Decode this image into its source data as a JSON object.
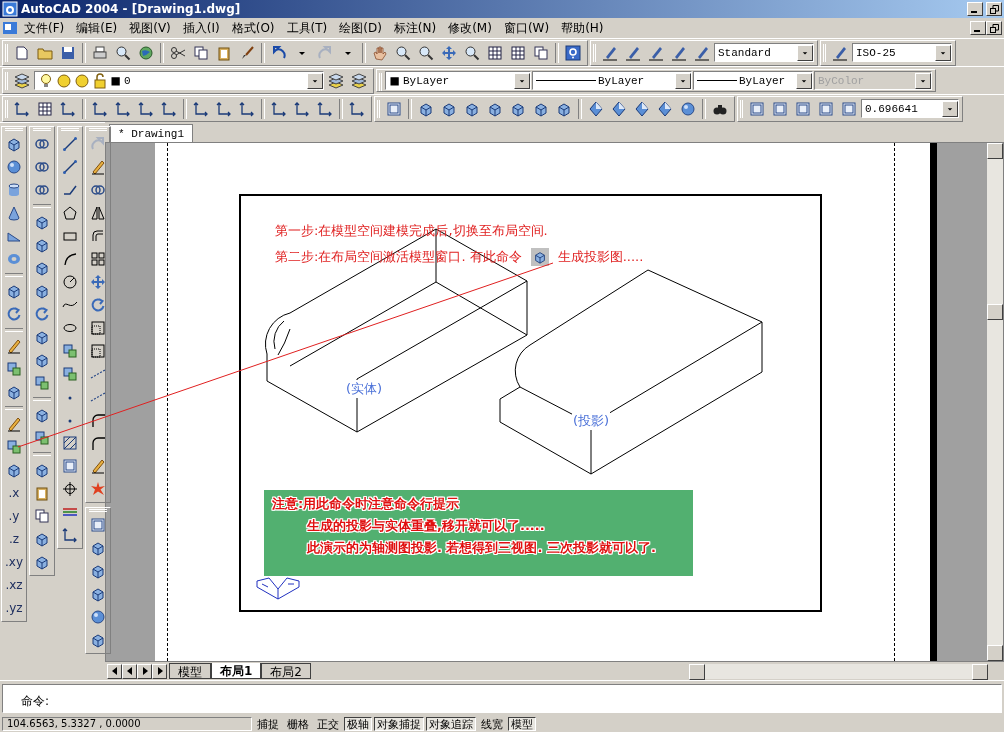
{
  "window": {
    "title": "AutoCAD 2004 - [Drawing1.dwg]"
  },
  "menu": [
    "文件(F)",
    "编辑(E)",
    "视图(V)",
    "插入(I)",
    "格式(O)",
    "工具(T)",
    "绘图(D)",
    "标注(N)",
    "修改(M)",
    "窗口(W)",
    "帮助(H)"
  ],
  "text_style": {
    "value": "Standard"
  },
  "dim_style": {
    "value": "ISO-25"
  },
  "layer": {
    "value": "0"
  },
  "color": {
    "value": "ByLayer"
  },
  "linetype": {
    "value": "ByLayer"
  },
  "lineweight": {
    "value": "ByLayer"
  },
  "plot_style": {
    "value": "ByColor",
    "disabled": true
  },
  "view_scale": {
    "value": "0.696641"
  },
  "coordinate_toolbar": [
    ".x",
    ".y",
    ".z",
    ".xy",
    ".xz",
    ".yz"
  ],
  "document_tab": {
    "title": "* Drawing1"
  },
  "drawing": {
    "steps": [
      "第一步:在模型空间建模完成后,切换至布局空间.",
      "第二步:在布局空间激活模型窗口. 有此命令"
    ],
    "step_suffix": "生成投影图.....",
    "labels": [
      {
        "text": "(实体)"
      },
      {
        "text": "(投影)"
      }
    ],
    "note": {
      "title": "注意:用此命令时注意命令行提示",
      "lines": [
        "生成的投影与实体重叠,移开就可以了.....",
        "此演示的为轴测图投影. 若想得到三视图. 三次投影就可以了."
      ]
    }
  },
  "layout_tabs": [
    {
      "label": "模型",
      "selected": false
    },
    {
      "label": "布局1",
      "selected": true
    },
    {
      "label": "布局2",
      "selected": false
    }
  ],
  "command_line": {
    "prompt": "命令:"
  },
  "status_bar": {
    "coordinates": "104.6563, 5.3327 , 0.0000",
    "toggles": [
      {
        "label": "捕捉",
        "on": false
      },
      {
        "label": "栅格",
        "on": false
      },
      {
        "label": "正交",
        "on": false
      },
      {
        "label": "极轴",
        "on": true
      },
      {
        "label": "对象捕捉",
        "on": true
      },
      {
        "label": "对象追踪",
        "on": true
      },
      {
        "label": "线宽",
        "on": false
      },
      {
        "label": "模型",
        "on": true
      }
    ]
  }
}
